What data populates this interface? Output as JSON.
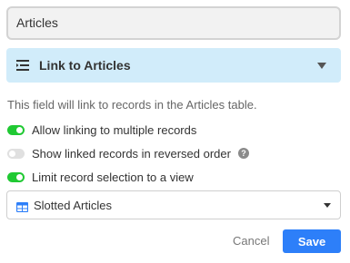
{
  "field_name": {
    "value": "Articles"
  },
  "field_type": {
    "label": "Link to Articles",
    "icon": "link-list-icon"
  },
  "description": "This field will link to records in the Articles table.",
  "options": [
    {
      "label": "Allow linking to multiple records",
      "enabled": true
    },
    {
      "label": "Show linked records in reversed order",
      "enabled": false,
      "help": "?"
    },
    {
      "label": "Limit record selection to a view",
      "enabled": true
    }
  ],
  "view_select": {
    "selected": "Slotted Articles",
    "icon": "grid-view-icon"
  },
  "actions": {
    "cancel_label": "Cancel",
    "save_label": "Save"
  },
  "colors": {
    "accent": "#2d7ff9",
    "toggle_on": "#20c933",
    "type_bg": "#d1ecfa"
  }
}
